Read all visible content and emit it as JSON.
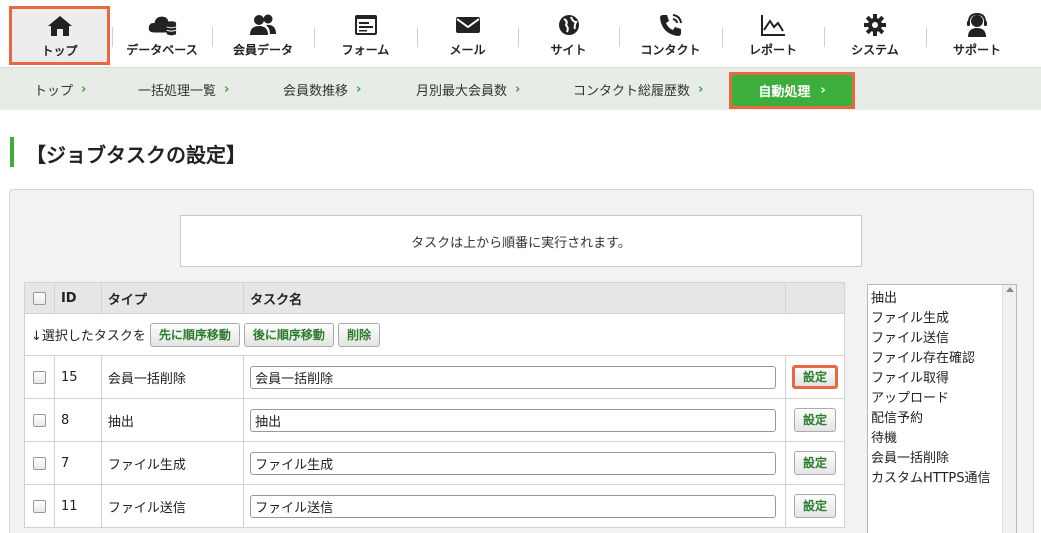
{
  "nav": [
    {
      "label": "トップ",
      "icon": "home-icon"
    },
    {
      "label": "データベース",
      "icon": "cloud-database-icon"
    },
    {
      "label": "会員データ",
      "icon": "users-icon"
    },
    {
      "label": "フォーム",
      "icon": "form-icon"
    },
    {
      "label": "メール",
      "icon": "mail-icon"
    },
    {
      "label": "サイト",
      "icon": "globe-icon"
    },
    {
      "label": "コンタクト",
      "icon": "phone-icon"
    },
    {
      "label": "レポート",
      "icon": "chart-icon"
    },
    {
      "label": "システム",
      "icon": "gear-icon"
    },
    {
      "label": "サポート",
      "icon": "headset-icon"
    }
  ],
  "breadcrumb": [
    {
      "label": "トップ"
    },
    {
      "label": "一括処理一覧"
    },
    {
      "label": "会員数推移"
    },
    {
      "label": "月別最大会員数"
    },
    {
      "label": "コンタクト総履歴数"
    }
  ],
  "breadcrumb_active": "自動処理",
  "arrow": "›",
  "page_title": "【ジョブタスクの設定】",
  "notice": "タスクは上から順番に実行されます。",
  "table": {
    "headers": {
      "id": "ID",
      "type": "タイプ",
      "name": "タスク名"
    },
    "bulk": {
      "label": "↓選択したタスクを",
      "move_up": "先に順序移動",
      "move_down": "後に順序移動",
      "delete": "削除"
    },
    "rows": [
      {
        "id": "15",
        "type": "会員一括削除",
        "name": "会員一括削除",
        "action": "設定"
      },
      {
        "id": "8",
        "type": "抽出",
        "name": "抽出",
        "action": "設定"
      },
      {
        "id": "7",
        "type": "ファイル生成",
        "name": "ファイル生成",
        "action": "設定"
      },
      {
        "id": "11",
        "type": "ファイル送信",
        "name": "ファイル送信",
        "action": "設定"
      }
    ]
  },
  "task_types": [
    "抽出",
    "ファイル生成",
    "ファイル送信",
    "ファイル存在確認",
    "ファイル取得",
    "アップロード",
    "配信予約",
    "待機",
    "会員一括削除",
    "カスタムHTTPS通信"
  ],
  "colors": {
    "accent_green": "#3cae3c",
    "highlight_orange": "#e8683f"
  }
}
